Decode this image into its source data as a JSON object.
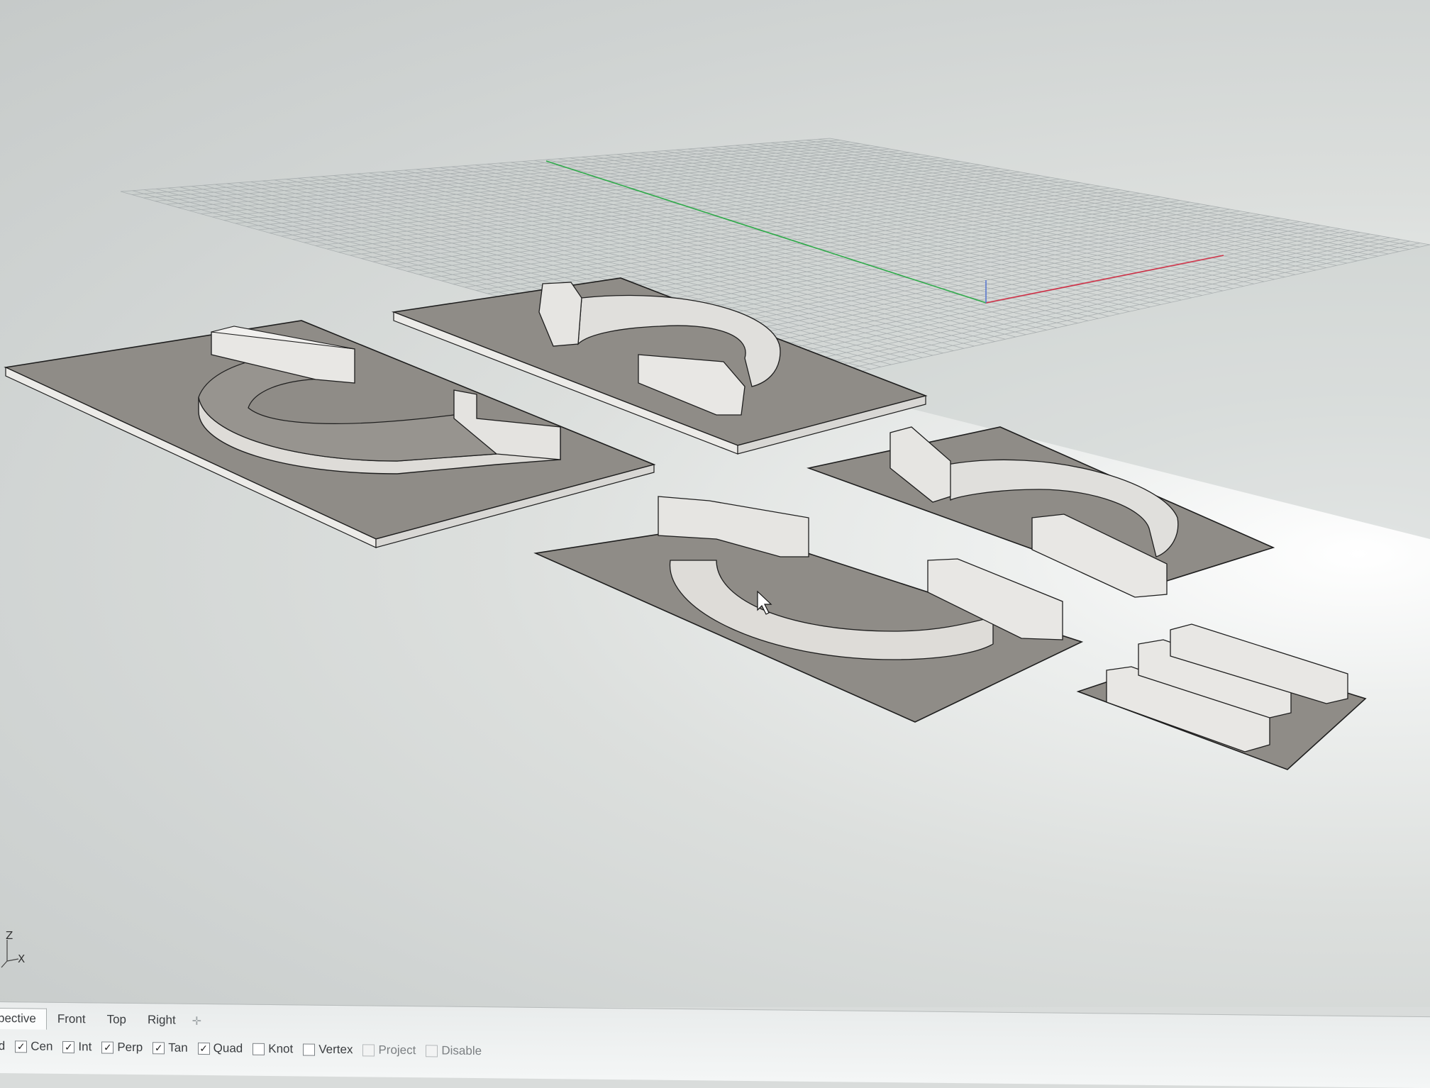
{
  "viewport": {
    "axis_labels": {
      "z": "Z",
      "x": "X"
    }
  },
  "viewport_tabs": [
    {
      "label": "pective",
      "active": true
    },
    {
      "label": "Front",
      "active": false
    },
    {
      "label": "Top",
      "active": false
    },
    {
      "label": "Right",
      "active": false
    }
  ],
  "add_tab_icon": "plus-icon",
  "osnaps": [
    {
      "label": "id",
      "checked": false,
      "partial": true
    },
    {
      "label": "Cen",
      "checked": true
    },
    {
      "label": "Int",
      "checked": true
    },
    {
      "label": "Perp",
      "checked": true
    },
    {
      "label": "Tan",
      "checked": true
    },
    {
      "label": "Quad",
      "checked": true
    },
    {
      "label": "Knot",
      "checked": false
    },
    {
      "label": "Vertex",
      "checked": false
    },
    {
      "label": "Project",
      "checked": false,
      "disabled": true
    },
    {
      "label": "Disable",
      "checked": false,
      "disabled": true
    }
  ],
  "colors": {
    "x_axis": "#d2344a",
    "y_axis": "#2faa4a",
    "grid": "#9aa0a2",
    "plate": "#8e8b86",
    "part_face": "#e3e2df"
  }
}
